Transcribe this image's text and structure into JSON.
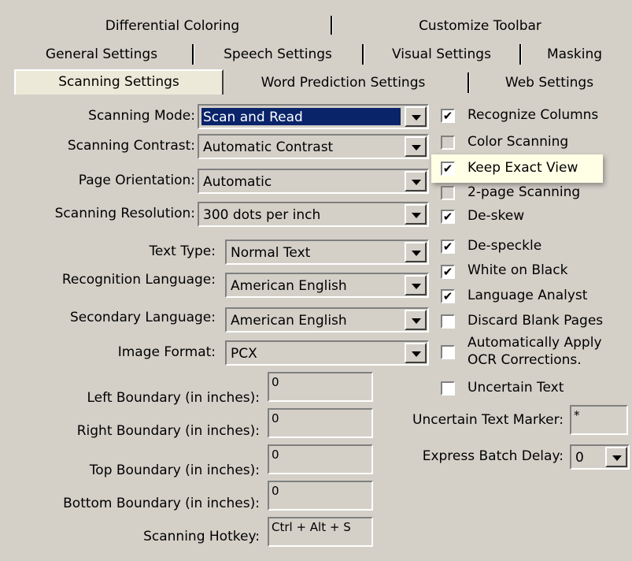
{
  "tabs": {
    "row1": [
      "Differential Coloring",
      "Customize Toolbar"
    ],
    "row2": [
      "General Settings",
      "Speech Settings",
      "Visual Settings",
      "Masking"
    ],
    "row3": [
      "Scanning Settings",
      "Word Prediction Settings",
      "Web Settings"
    ],
    "selected": "Scanning Settings"
  },
  "dropdowns": {
    "scanning_mode": {
      "label": "Scanning Mode:",
      "value": "Scan and Read"
    },
    "scanning_contrast": {
      "label": "Scanning Contrast:",
      "value": "Automatic Contrast"
    },
    "page_orientation": {
      "label": "Page Orientation:",
      "value": "Automatic"
    },
    "scanning_resolution": {
      "label": "Scanning Resolution:",
      "value": "300 dots per inch"
    },
    "text_type": {
      "label": "Text Type:",
      "value": "Normal Text"
    },
    "recognition_language": {
      "label": "Recognition Language:",
      "value": "American English"
    },
    "secondary_language": {
      "label": "Secondary Language:",
      "value": "American English"
    },
    "image_format": {
      "label": "Image Format:",
      "value": "PCX"
    },
    "express_batch_delay": {
      "label": "Express Batch Delay:",
      "value": "0"
    }
  },
  "fields": {
    "left_boundary": {
      "label": "Left Boundary (in inches):",
      "value": "0"
    },
    "right_boundary": {
      "label": "Right Boundary (in inches):",
      "value": "0"
    },
    "top_boundary": {
      "label": "Top Boundary (in inches):",
      "value": "0"
    },
    "bottom_boundary": {
      "label": "Bottom Boundary (in inches):",
      "value": "0"
    },
    "scanning_hotkey": {
      "label": "Scanning Hotkey:",
      "value": "Ctrl + Alt + S"
    },
    "uncertain_text_marker": {
      "label": "Uncertain Text Marker:",
      "value": "*"
    }
  },
  "checkboxes": [
    {
      "label": "Recognize Columns",
      "checked": true
    },
    {
      "label": "Color Scanning",
      "checked": false
    },
    {
      "label": "Keep Exact View",
      "checked": true,
      "highlighted": true
    },
    {
      "label": "2-page Scanning",
      "checked": false
    },
    {
      "label": "De-skew",
      "checked": true
    },
    {
      "label": "De-speckle",
      "checked": true
    },
    {
      "label": "White on Black",
      "checked": true
    },
    {
      "label": "Language Analyst",
      "checked": true
    },
    {
      "label": "Discard Blank Pages",
      "checked": false
    },
    {
      "label_line1": "Automatically Apply",
      "label_line2": "OCR Corrections.",
      "checked": false
    },
    {
      "label": "Uncertain Text",
      "checked": false
    }
  ],
  "check_mark": "✔"
}
